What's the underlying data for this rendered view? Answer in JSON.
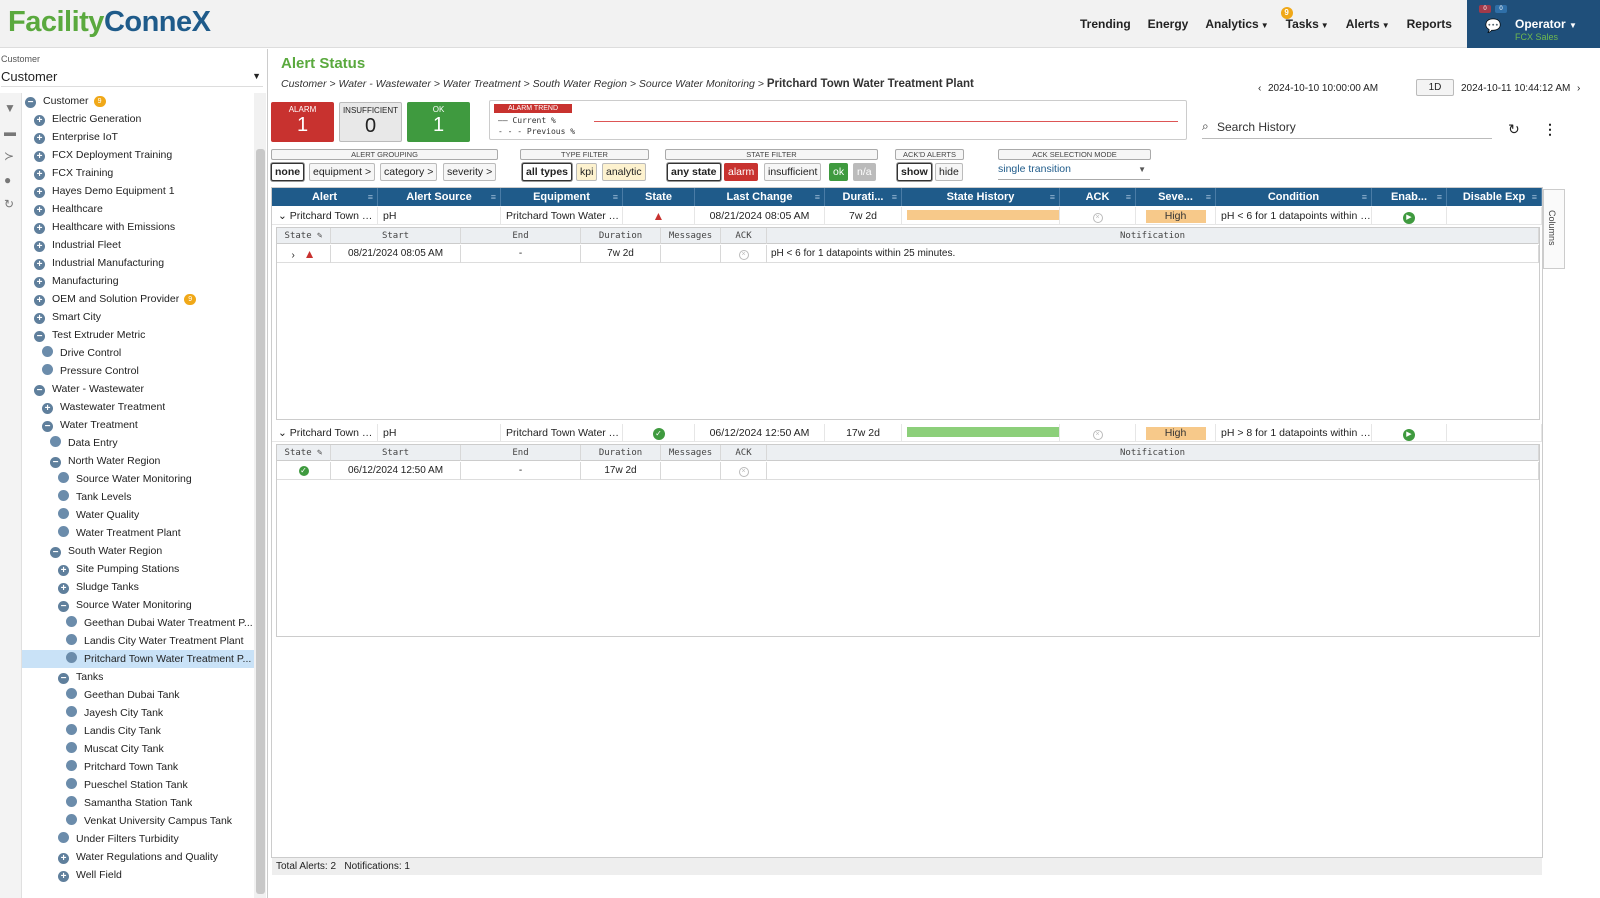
{
  "app": {
    "logo_part1": "Facility",
    "logo_part2": "Conne",
    "logo_x": "X"
  },
  "nav": {
    "items": [
      {
        "label": "Trending"
      },
      {
        "label": "Energy"
      },
      {
        "label": "Analytics"
      },
      {
        "label": "Tasks",
        "badge": "9"
      },
      {
        "label": "Alerts"
      },
      {
        "label": "Reports"
      }
    ]
  },
  "user": {
    "name": "Operator",
    "org": "FCX Sales",
    "chat_count": "0",
    "mini1": "0",
    "mini2": "0"
  },
  "sidebar": {
    "caption": "Customer",
    "selected": "Customer",
    "tree": [
      {
        "label": "Customer",
        "badge": "9",
        "type": "minus",
        "depth": 0
      },
      {
        "label": "Electric Generation",
        "type": "plus",
        "depth": 1
      },
      {
        "label": "Enterprise IoT",
        "type": "plus",
        "depth": 1
      },
      {
        "label": "FCX Deployment Training",
        "type": "plus",
        "depth": 1
      },
      {
        "label": "FCX Training",
        "type": "plus",
        "depth": 1
      },
      {
        "label": "Hayes Demo Equipment 1",
        "type": "plus",
        "depth": 1
      },
      {
        "label": "Healthcare",
        "type": "plus",
        "depth": 1
      },
      {
        "label": "Healthcare with Emissions",
        "type": "plus",
        "depth": 1
      },
      {
        "label": "Industrial Fleet",
        "type": "plus",
        "depth": 1
      },
      {
        "label": "Industrial Manufacturing",
        "type": "plus",
        "depth": 1
      },
      {
        "label": "Manufacturing",
        "type": "plus",
        "depth": 1
      },
      {
        "label": "OEM and Solution Provider",
        "badge": "9",
        "type": "plus",
        "depth": 1
      },
      {
        "label": "Smart City",
        "type": "plus",
        "depth": 1
      },
      {
        "label": "Test Extruder Metric",
        "type": "minus",
        "depth": 1
      },
      {
        "label": "Drive Control",
        "type": "dot",
        "depth": 2
      },
      {
        "label": "Pressure Control",
        "type": "dot",
        "depth": 2
      },
      {
        "label": "Water - Wastewater",
        "type": "minus",
        "depth": 1
      },
      {
        "label": "Wastewater Treatment",
        "type": "plus",
        "depth": 2
      },
      {
        "label": "Water Treatment",
        "type": "minus",
        "depth": 2
      },
      {
        "label": "Data Entry",
        "type": "dot",
        "depth": 3
      },
      {
        "label": "North Water Region",
        "type": "minus",
        "depth": 3
      },
      {
        "label": "Source Water Monitoring",
        "type": "dot",
        "depth": 4
      },
      {
        "label": "Tank Levels",
        "type": "dot",
        "depth": 4
      },
      {
        "label": "Water Quality",
        "type": "dot",
        "depth": 4
      },
      {
        "label": "Water Treatment Plant",
        "type": "dot",
        "depth": 4
      },
      {
        "label": "South Water Region",
        "type": "minus",
        "depth": 3
      },
      {
        "label": "Site Pumping Stations",
        "type": "plus",
        "depth": 4
      },
      {
        "label": "Sludge Tanks",
        "type": "plus",
        "depth": 4
      },
      {
        "label": "Source Water Monitoring",
        "type": "minus",
        "depth": 4
      },
      {
        "label": "Geethan Dubai Water Treatment P...",
        "type": "dot",
        "depth": 5
      },
      {
        "label": "Landis City Water Treatment Plant",
        "type": "dot",
        "depth": 5
      },
      {
        "label": "Pritchard Town Water Treatment P...",
        "type": "dot",
        "depth": 5,
        "selected": true
      },
      {
        "label": "Tanks",
        "type": "minus",
        "depth": 4
      },
      {
        "label": "Geethan Dubai Tank",
        "type": "dot",
        "depth": 5
      },
      {
        "label": "Jayesh City Tank",
        "type": "dot",
        "depth": 5
      },
      {
        "label": "Landis City Tank",
        "type": "dot",
        "depth": 5
      },
      {
        "label": "Muscat City Tank",
        "type": "dot",
        "depth": 5
      },
      {
        "label": "Pritchard Town Tank",
        "type": "dot",
        "depth": 5
      },
      {
        "label": "Pueschel Station Tank",
        "type": "dot",
        "depth": 5
      },
      {
        "label": "Samantha Station Tank",
        "type": "dot",
        "depth": 5
      },
      {
        "label": "Venkat University Campus Tank",
        "type": "dot",
        "depth": 5
      },
      {
        "label": "Under Filters Turbidity",
        "type": "dot",
        "depth": 4
      },
      {
        "label": "Water Regulations and Quality",
        "type": "plus",
        "depth": 4
      },
      {
        "label": "Well Field",
        "type": "plus",
        "depth": 4
      }
    ]
  },
  "main": {
    "title": "Alert Status",
    "breadcrumb": "Customer > Water - Wastewater > Water Treatment > South Water Region > Source Water Monitoring >",
    "breadcrumb_current": "Pritchard Town Water Treatment Plant",
    "date_from": "2024-10-10 10:00:00 AM",
    "range": "1D",
    "date_to": "2024-10-11 10:44:12 AM",
    "summary": [
      {
        "label": "ALARM",
        "count": "1",
        "color": "#c8322f"
      },
      {
        "label": "INSUFFICIENT",
        "count": "0",
        "color": "#e8e8e8"
      },
      {
        "label": "OK",
        "count": "1",
        "color": "#3f9a3f"
      }
    ],
    "trend": {
      "label": "ALARM TREND",
      "current": "Current %",
      "previous": "Previous %"
    },
    "search_placeholder": "Search History",
    "filters": {
      "grouping": {
        "caption": "ALERT GROUPING",
        "options": [
          "none",
          "equipment >",
          "category >",
          "severity >"
        ]
      },
      "type": {
        "caption": "TYPE FILTER",
        "options": [
          "all types",
          "kpi",
          "analytic"
        ]
      },
      "state": {
        "caption": "STATE FILTER",
        "options": [
          "any state",
          "alarm",
          "insufficient",
          "ok",
          "n/a"
        ]
      },
      "ackd": {
        "caption": "ACK'D ALERTS",
        "options": [
          "show",
          "hide"
        ]
      },
      "ackmode": {
        "caption": "ACK SELECTION MODE",
        "value": "single transition"
      }
    },
    "columns": [
      "Alert",
      "Alert Source",
      "Equipment",
      "State",
      "Last Change",
      "Durati...",
      "State History",
      "ACK",
      "Seve...",
      "Condition",
      "Enab...",
      "Disable Exp"
    ],
    "sub_columns": [
      "State",
      "Start",
      "End",
      "Duration",
      "Messages",
      "ACK",
      "Notification"
    ],
    "alerts": [
      {
        "alert": "Pritchard Town WT...",
        "source": "pH",
        "equipment": "Pritchard Town Water T...",
        "state": "alarm",
        "last_change": "08/21/2024 08:05 AM",
        "duration": "7w 2d",
        "history_color": "#f7c98a",
        "severity": "High",
        "condition": "pH < 6 for 1 datapoints within 25 min...",
        "details": [
          {
            "start": "08/21/2024 08:05 AM",
            "end": "-",
            "duration": "7w 2d",
            "messages": "",
            "notification": "pH < 6 for 1 datapoints within 25 minutes."
          }
        ]
      },
      {
        "alert": "Pritchard Town WT...",
        "source": "pH",
        "equipment": "Pritchard Town Water T...",
        "state": "ok",
        "last_change": "06/12/2024 12:50 AM",
        "duration": "17w 2d",
        "history_color": "#8ccf7a",
        "severity": "High",
        "condition": "pH > 8 for 1 datapoints within 25 min...",
        "details": [
          {
            "start": "06/12/2024 12:50 AM",
            "end": "-",
            "duration": "17w 2d",
            "messages": "",
            "notification": ""
          }
        ]
      }
    ],
    "footer": {
      "total": "Total Alerts: 2",
      "notifications": "Notifications: 1"
    },
    "columns_side": "Columns"
  }
}
